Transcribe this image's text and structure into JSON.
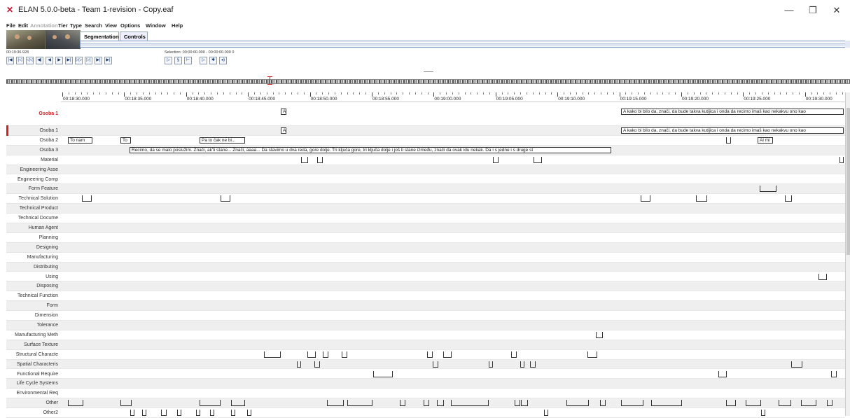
{
  "window": {
    "title": "ELAN 5.0.0-beta - Team 1-revision - Copy.eaf",
    "minimize": "—",
    "maximize": "❐",
    "close": "✕"
  },
  "menu": [
    "File",
    "Edit",
    "Annotation",
    "Tier",
    "Type",
    "Search",
    "View",
    "Options",
    "Window",
    "Help"
  ],
  "tabs": {
    "segmentation": "Segmentation",
    "controls": "Controls"
  },
  "media": {
    "time": "00:19:36.928",
    "selection": "Selection: 00:00:00.000 - 00:00:00.000  0"
  },
  "ruler": [
    "00:18:30.000",
    "00:18:35.000",
    "00:18:40.000",
    "00:18:45.000",
    "00:18:50.000",
    "00:18:55.000",
    "00:19:00.000",
    "00:19:05.000",
    "00:19:10.000",
    "00:19:15.000",
    "00:19:20.000",
    "00:19:25.000",
    "00:19:30.000"
  ],
  "tiers": [
    "Osoba 1",
    "Osoba 1",
    "Osoba 2",
    "Osoba 3",
    "Material",
    "Engineering Asse",
    "Engineering Comp",
    "Form Feature",
    "Technical Solution",
    "Technical Product",
    "Technical Docume",
    "Human Agent",
    "Planning",
    "Designing",
    "Manufacturing",
    "Distributing",
    "Using",
    "Disposing",
    "Technical Function",
    "Form",
    "Dimension",
    "Tolerance",
    "Manufacturing Meth",
    "Surface Texture",
    "Structural Characte",
    "Spatial Characteris",
    "Functional Require",
    "Life Cycle Systems",
    "Environmental Req",
    "Other",
    "Other2"
  ],
  "annotations": {
    "osoba1_a": "A",
    "osoba1_long": "A kako bi bilo da, znači, da bude takva kutijica i onda da recimo imaš kao nekakvu ono kao",
    "osoba2_a": "To nam",
    "osoba2_b": "To",
    "osoba2_c": "Pa to čak ne bi...",
    "osoba2_d": "Al mi",
    "osoba3_a": "Recimo, da se malo poslužim. Znači, ak'ti stane... Znači, aaaa... Da stavimo u dva reda, gore dolje. Tri ključa gore, tri ključa dolje i još ti stane između, znači da ovak idu nekak. Da i s jedne i s druge st"
  }
}
